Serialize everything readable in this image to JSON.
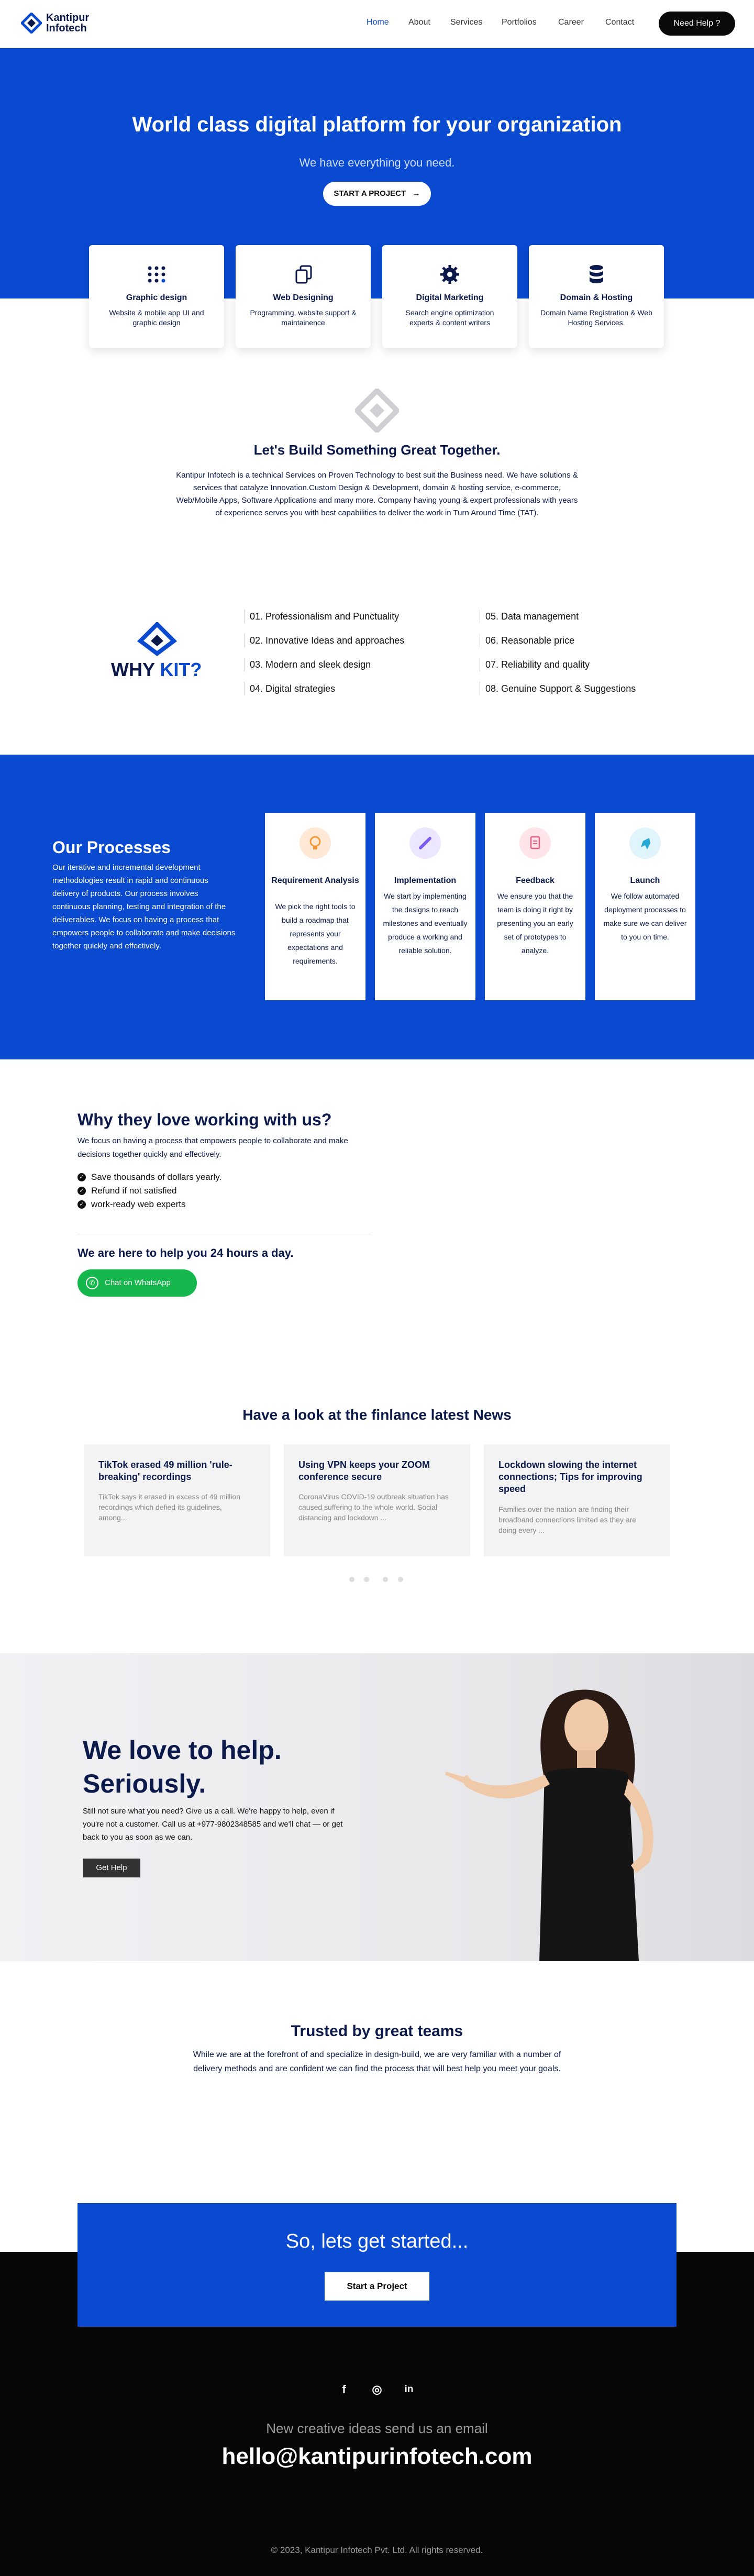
{
  "header": {
    "logo_line1": "Kantipur",
    "logo_line2": "Infotech",
    "nav": [
      "Home",
      "About",
      "Services",
      "Portfolios",
      "Career",
      "Contact"
    ],
    "help_button": "Need Help ?",
    "active_color": "#0a4ad1"
  },
  "hero": {
    "title": "World class digital platform for your organization",
    "subtitle": "We have everything you need.",
    "button": "START A PROJECT",
    "button_icon": "arrow-right-icon",
    "background": "#0a4ad1"
  },
  "services": [
    {
      "title": "Graphic design",
      "desc": "Website & mobile app UI and graphic design",
      "icon": "grid-dots-icon"
    },
    {
      "title": "Web Designing",
      "desc": "Programming, website support & maintainence",
      "icon": "copy-pages-icon"
    },
    {
      "title": "Digital Marketing",
      "desc": "Search engine optimization experts & content writers",
      "icon": "gear-icon"
    },
    {
      "title": "Domain & Hosting",
      "desc": "Domain Name Registration & Web Hosting Services.",
      "icon": "database-icon"
    }
  ],
  "about": {
    "title": "Let's Build Something Great Together.",
    "text": "Kantipur Infotech is a technical Services on Proven Technology to best suit the Business need. We have solutions & services that catalyze Innovation.Custom Design & Development, domain & hosting service, e-commerce, Web/Mobile Apps, Software Applications and many more. Company having young & expert professionals with years of experience serves you with best capabilities to deliver the work in Turn Around Time (TAT)."
  },
  "why": {
    "title_prefix": "WHY ",
    "title_accent": "KIT?",
    "items": [
      "01. Professionalism and Punctuality",
      "02. Innovative Ideas and approaches",
      "03. Modern and sleek design",
      "04. Digital strategies",
      "05. Data management",
      "06. Reasonable price",
      "07. Reliability and quality",
      "08. Genuine Support & Suggestions"
    ]
  },
  "processes": {
    "title": "Our Processes",
    "text": "Our iterative and incremental development methodologies result in rapid and continuous delivery of products. Our process involves continuous planning, testing and integration of the deliverables. We focus on having a process that empowers people to collaborate and make decisions together quickly and effectively.",
    "cards": [
      {
        "title": "Requirement Analysis",
        "desc": "We pick the right tools to build a roadmap that represents your expectations and requirements.",
        "icon": "lightbulb-icon",
        "color": "#ffe9d6"
      },
      {
        "title": "Implementation",
        "desc": "We start by implementing the designs to reach milestones and eventually produce a working and reliable solution.",
        "icon": "pencil-icon",
        "color": "#ece6ff"
      },
      {
        "title": "Feedback",
        "desc": "We ensure you that the team is doing it right by presenting you an early set of prototypes to analyze.",
        "icon": "document-icon",
        "color": "#ffe4ea"
      },
      {
        "title": "Launch",
        "desc": "We follow automated deployment processes to make sure we can deliver to you on time.",
        "icon": "rocket-icon",
        "color": "#dff4fb"
      }
    ]
  },
  "love": {
    "title": "Why they love working with us?",
    "text": "We focus on having a process that empowers people to collaborate and make decisions together quickly and effectively.",
    "checks": [
      "Save thousands of dollars yearly.",
      "Refund if not satisfied",
      "work-ready web experts"
    ],
    "help24": "We are here to help you 24 hours a day.",
    "whatsapp": "Chat on WhatsApp"
  },
  "news": {
    "title": "Have a look at the finlance latest News",
    "items": [
      {
        "title": "TikTok erased 49 million 'rule-breaking' recordings",
        "desc": "TikTok says it erased in excess of 49 million recordings which defied its guidelines, among..."
      },
      {
        "title": "Using VPN keeps your ZOOM conference secure",
        "desc": "CoronaVirus COVID-19 outbreak situation has caused suffering to the whole world. Social distancing and lockdown ..."
      },
      {
        "title": "Lockdown slowing the internet connections; Tips for improving speed",
        "desc": "Families over the nation are finding their broadband connections limited as they are doing every ..."
      }
    ]
  },
  "help": {
    "title_line1": "We love to help.",
    "title_line2": "Seriously.",
    "text": "Still not sure what you need? Give us a call. We're happy to help, even if you're not a customer. Call us at +977-9802348585 and we'll chat — or get back to you as soon as we can.",
    "button": "Get Help"
  },
  "trusted": {
    "title": "Trusted by great teams",
    "text": "While we are at the forefront of and specialize in design-build, we are very familiar with a number of delivery methods and are confident we can find the process that will best help you meet your goals."
  },
  "cta": {
    "title": "So, lets get started...",
    "button": "Start a Project"
  },
  "footer": {
    "social": [
      {
        "icon": "facebook-icon",
        "glyph": "f"
      },
      {
        "icon": "instagram-icon",
        "glyph": "◎"
      },
      {
        "icon": "linkedin-icon",
        "glyph": "in"
      }
    ],
    "email_label": "New creative ideas send us an email",
    "email": "hello@kantipurinfotech.com",
    "copyright": "© 2023, Kantipur Infotech Pvt. Ltd. All rights reserved."
  }
}
